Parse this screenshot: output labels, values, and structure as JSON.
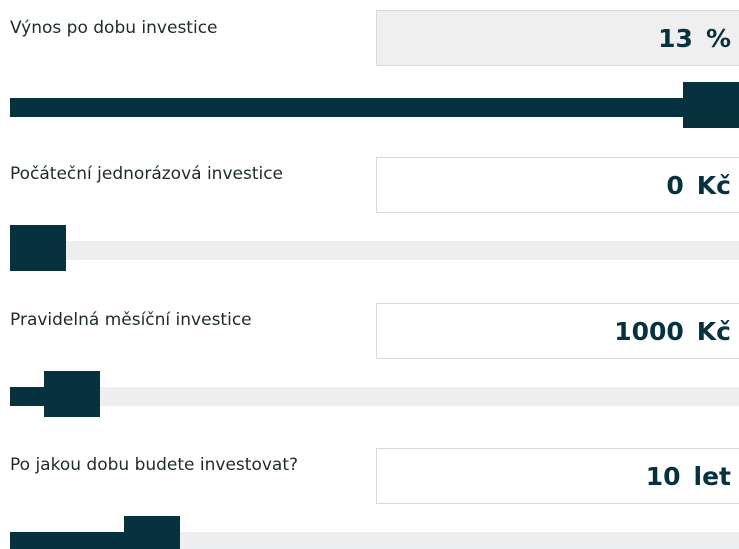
{
  "fields": [
    {
      "label": "Výnos po dobu investice",
      "value": "13",
      "unit": "%",
      "slider_fraction": 1.0
    },
    {
      "label": "Počáteční jednorázová investice",
      "value": "0",
      "unit": "Kč",
      "slider_fraction": 0.0
    },
    {
      "label": "Pravidelná měsíční investice",
      "value": "1000",
      "unit": "Kč",
      "slider_fraction": 0.05
    },
    {
      "label": "Po jakou dobu budete investovat?",
      "value": "10",
      "unit": "let",
      "slider_fraction": 0.17
    }
  ],
  "colors": {
    "accent": "#06323f",
    "track": "#eceeef",
    "readonly_box": "#efefef",
    "border": "#d7dadb"
  }
}
